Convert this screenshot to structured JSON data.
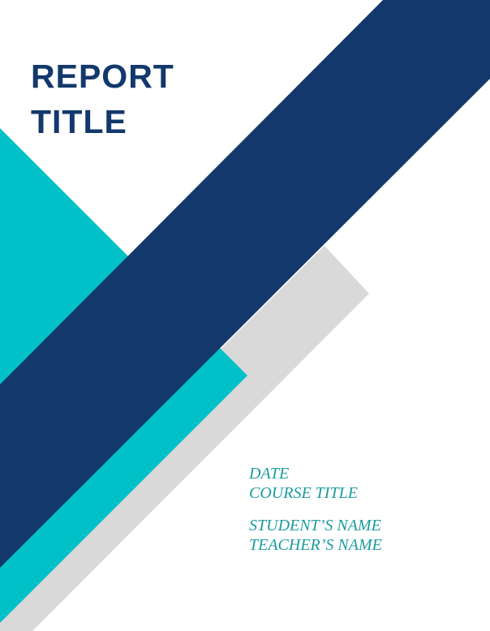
{
  "cover": {
    "title_line_1": "REPORT",
    "title_line_2": "TITLE",
    "date": "DATE",
    "course_title": "COURSE TITLE",
    "student_name": "STUDENT’S NAME",
    "teacher_name": "TEACHER’S NAME"
  },
  "colors": {
    "navy": "#13386B",
    "teal": "#00C1C8",
    "gray": "#D9D9D9",
    "detail_text": "#1A9C9E"
  }
}
